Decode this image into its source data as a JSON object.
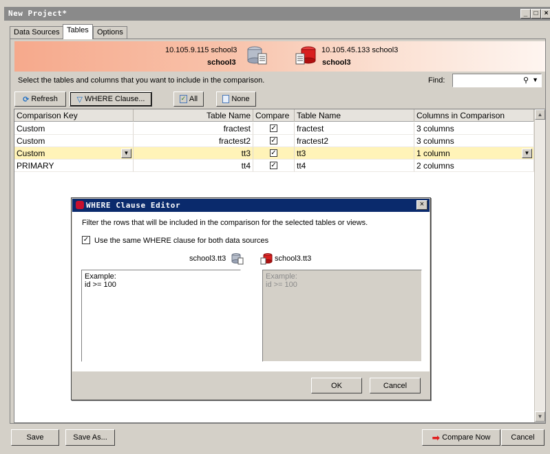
{
  "window": {
    "title": "New Project*",
    "min_glyph": "_",
    "max_glyph": "□",
    "close_glyph": "×"
  },
  "tabs": [
    {
      "label": "Data Sources"
    },
    {
      "label": "Tables"
    },
    {
      "label": "Options"
    }
  ],
  "header": {
    "left_server": "10.105.9.115 school3",
    "left_db": "school3",
    "right_server": "10.105.45.133 school3",
    "right_db": "school3",
    "left_color": "#9aa3b5",
    "right_color": "#d81f1f"
  },
  "instructions": "Select the tables and columns that you want to include in the comparison.",
  "find": {
    "label": "Find:",
    "value": "",
    "icon": "search-icon"
  },
  "toolbar": {
    "refresh": "Refresh",
    "where_clause": "WHERE Clause...",
    "all": "All",
    "none": "None"
  },
  "grid": {
    "columns": [
      "Comparison Key",
      "Table Name",
      "Compare",
      "Table Name",
      "Columns in Comparison"
    ],
    "rows": [
      {
        "key": "Custom",
        "left_table": "fractest",
        "compare": true,
        "right_table": "fractest",
        "columns": "3 columns"
      },
      {
        "key": "Custom",
        "left_table": "fractest2",
        "compare": true,
        "right_table": "fractest2",
        "columns": "3 columns"
      },
      {
        "key": "Custom",
        "left_table": "tt3",
        "compare": true,
        "right_table": "tt3",
        "columns": "1 column"
      },
      {
        "key": "PRIMARY",
        "left_table": "tt4",
        "compare": true,
        "right_table": "tt4",
        "columns": "2 columns"
      }
    ],
    "selected_row": 2,
    "selected_color": "#fff3b8"
  },
  "footer": {
    "save": "Save",
    "save_as": "Save As...",
    "compare_now": "Compare Now",
    "cancel": "Cancel"
  },
  "dialog": {
    "title": "WHERE Clause Editor",
    "description": "Filter the rows that will be included in the comparison for the selected tables or views.",
    "same_clause_label": "Use the same WHERE clause for both data sources",
    "same_clause_checked": true,
    "left_table": "school3.tt3",
    "right_table": "school3.tt3",
    "left_text": "Example:\nid >= 100",
    "right_text": "Example:\nid >= 100",
    "ok": "OK",
    "cancel": "Cancel",
    "title_color": "#0a2a6c"
  }
}
